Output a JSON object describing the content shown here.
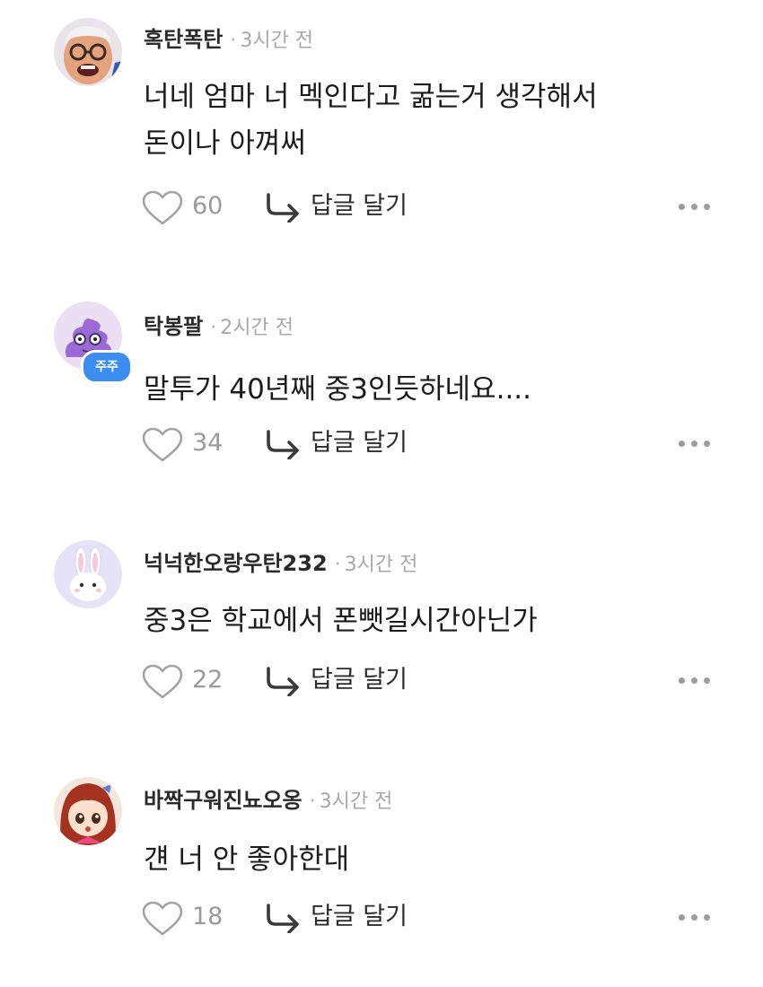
{
  "comments": [
    {
      "author": "혹탄폭탄",
      "separator": "·",
      "time": "3시간 전",
      "text": "너네 엄마 너 멕인다고 굶는거 생각해서\n돈이나 아껴써",
      "likes": "60",
      "reply_label": "답글 달기",
      "avatar_icon": "man-face-avatar",
      "badge": null
    },
    {
      "author": "탁봉팔",
      "separator": "·",
      "time": "2시간 전",
      "text": "말투가 40년째 중3인듯하네요....",
      "likes": "34",
      "reply_label": "답글 달기",
      "avatar_icon": "purple-character-avatar",
      "badge": "주주"
    },
    {
      "author": "넉넉한오랑우탄232",
      "separator": "·",
      "time": "3시간 전",
      "text": "중3은 학교에서 폰뺏길시간아닌가",
      "likes": "22",
      "reply_label": "답글 달기",
      "avatar_icon": "white-rabbit-avatar",
      "badge": null
    },
    {
      "author": "바짝구워진뇨오옹",
      "separator": "·",
      "time": "3시간 전",
      "text": "걘 너 안 좋아한대",
      "likes": "18",
      "reply_label": "답글 달기",
      "avatar_icon": "anime-girl-avatar",
      "badge": null
    }
  ],
  "icons": {
    "like": "heart-outline-icon",
    "reply": "reply-arrow-icon",
    "more": "more-dots-icon"
  },
  "colors": {
    "badge": "#3b8df0",
    "muted": "#9a9a9a"
  }
}
